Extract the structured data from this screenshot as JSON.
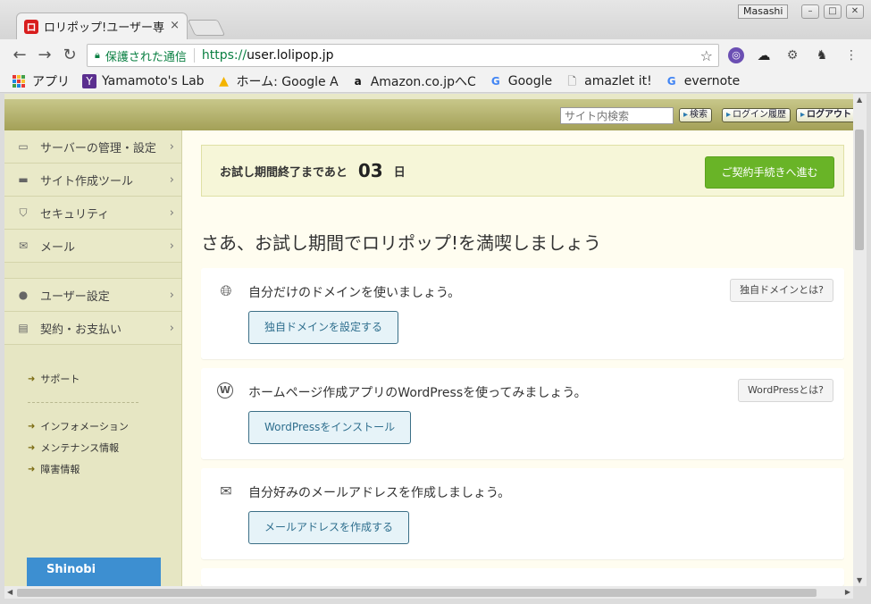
{
  "browser": {
    "tab_title": "ロリポップ!ユーザー専",
    "tab_close": "×",
    "user_name": "Masashi",
    "omnibox": {
      "secure_label": "保護された通信",
      "url_scheme": "https://",
      "url_host": "user.lolipop.jp"
    },
    "bookmarks": [
      "アプリ",
      "Yamamoto's Lab",
      "ホーム: Google A",
      "Amazon.co.jpへC",
      "Google",
      "amazlet it!",
      "evernote"
    ]
  },
  "header": {
    "search_placeholder": "サイト内検索",
    "search_btn": "検索",
    "history_btn": "ログイン履歴",
    "logout_btn": "ログアウト"
  },
  "sidebar": {
    "menu": [
      {
        "label": "サーバーの管理・設定",
        "icon": "server-icon"
      },
      {
        "label": "サイト作成ツール",
        "icon": "laptop-icon"
      },
      {
        "label": "セキュリティ",
        "icon": "shield-icon"
      },
      {
        "label": "メール",
        "icon": "mail-icon"
      }
    ],
    "menu2": [
      {
        "label": "ユーザー設定",
        "icon": "user-icon"
      },
      {
        "label": "契約・お支払い",
        "icon": "card-icon"
      }
    ],
    "links": [
      "サポート",
      "インフォメーション",
      "メンテナンス情報",
      "障害情報"
    ],
    "banner": "Shinobi"
  },
  "trial": {
    "label": "お試し期間終了まであと",
    "days": "03",
    "unit": "日",
    "button": "ご契約手続きへ進む"
  },
  "headline": "さあ、お試し期間でロリポップ!を満喫しましょう",
  "cards": [
    {
      "icon": "globe-icon",
      "text": "自分だけのドメインを使いましょう。",
      "help": "独自ドメインとは?",
      "button": "独自ドメインを設定する"
    },
    {
      "icon": "wordpress-icon",
      "text": "ホームページ作成アプリのWordPressを使ってみましょう。",
      "help": "WordPressとは?",
      "button": "WordPressをインストール"
    },
    {
      "icon": "envelope-icon",
      "text": "自分好みのメールアドレスを作成しましょう。",
      "help": "",
      "button": "メールアドレスを作成する"
    }
  ],
  "colors": {
    "header_gradient": "#a3a057",
    "sidebar_bg": "#e6e6c3",
    "page_bg": "#fffdf0",
    "cta_green": "#69b427",
    "btn_text": "#2f6f8e"
  }
}
